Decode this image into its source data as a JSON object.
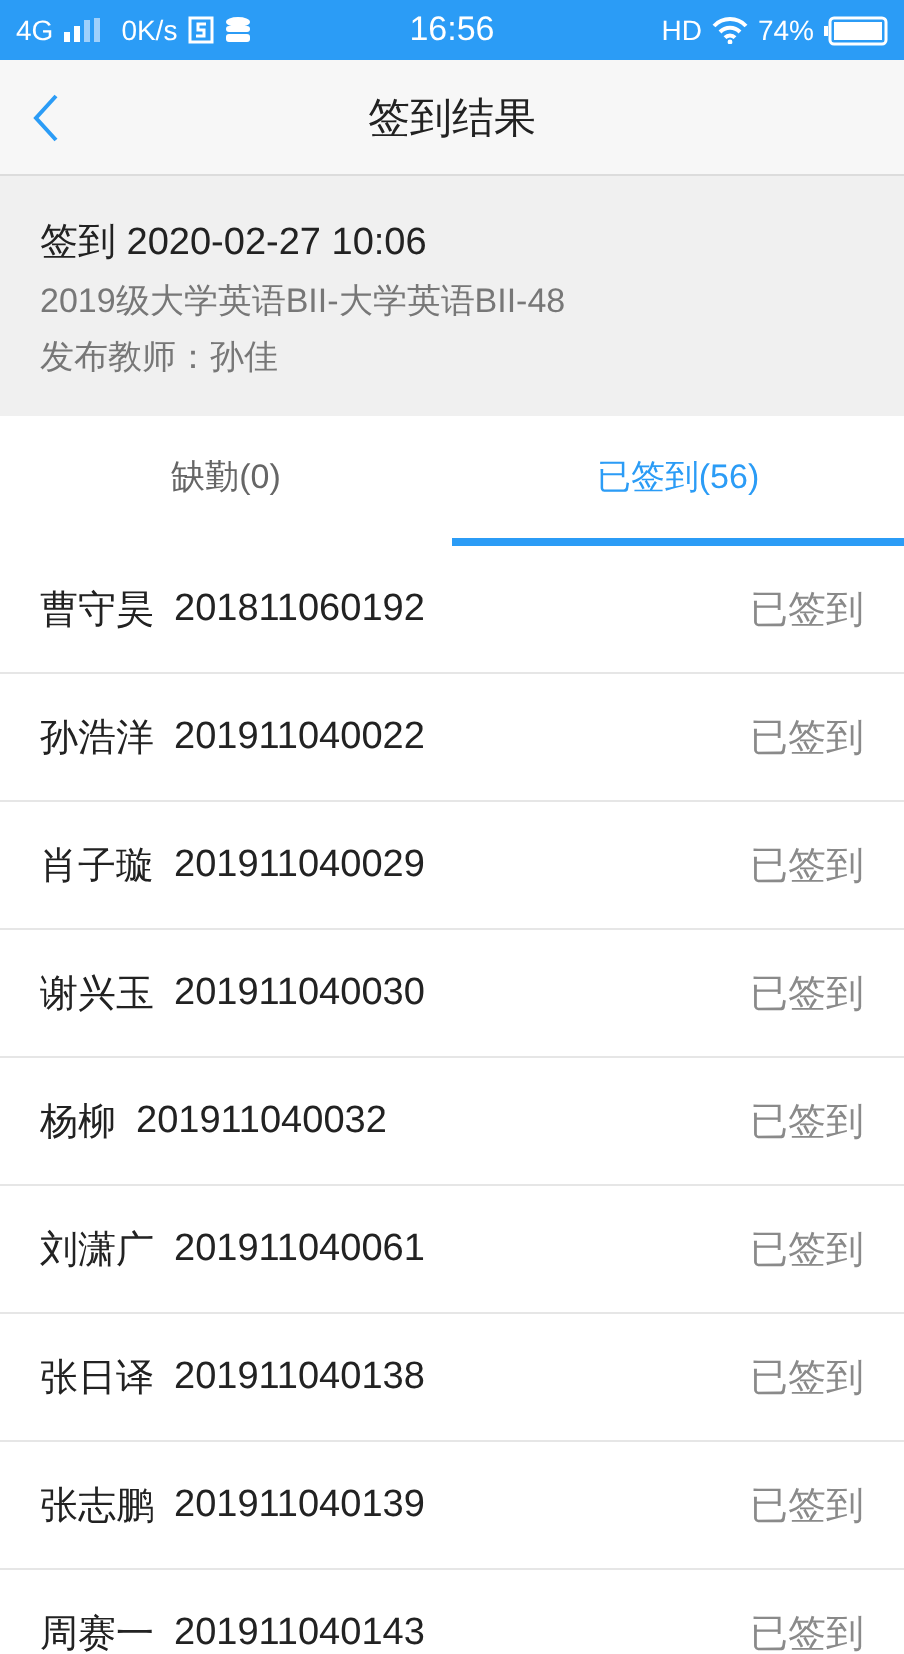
{
  "status_bar": {
    "network": "4G",
    "speed": "0K/s",
    "time": "16:56",
    "hd": "HD",
    "battery": "74%"
  },
  "header": {
    "title": "签到结果"
  },
  "info": {
    "title": "签到 2020-02-27 10:06",
    "course": "2019级大学英语BII-大学英语BII-48",
    "teacher": "发布教师：孙佳"
  },
  "tabs": [
    {
      "label": "缺勤(0)",
      "selected": false
    },
    {
      "label": "已签到(56)",
      "selected": true
    }
  ],
  "students": [
    {
      "name": "曹守昊",
      "id": "201811060192",
      "status": "已签到"
    },
    {
      "name": "孙浩洋",
      "id": "201911040022",
      "status": "已签到"
    },
    {
      "name": "肖子璇",
      "id": "201911040029",
      "status": "已签到"
    },
    {
      "name": "谢兴玉",
      "id": "201911040030",
      "status": "已签到"
    },
    {
      "name": "杨柳",
      "id": "201911040032",
      "status": "已签到"
    },
    {
      "name": "刘潇广",
      "id": "201911040061",
      "status": "已签到"
    },
    {
      "name": "张日译",
      "id": "201911040138",
      "status": "已签到"
    },
    {
      "name": "张志鹏",
      "id": "201911040139",
      "status": "已签到"
    },
    {
      "name": "周赛一",
      "id": "201911040143",
      "status": "已签到"
    }
  ]
}
